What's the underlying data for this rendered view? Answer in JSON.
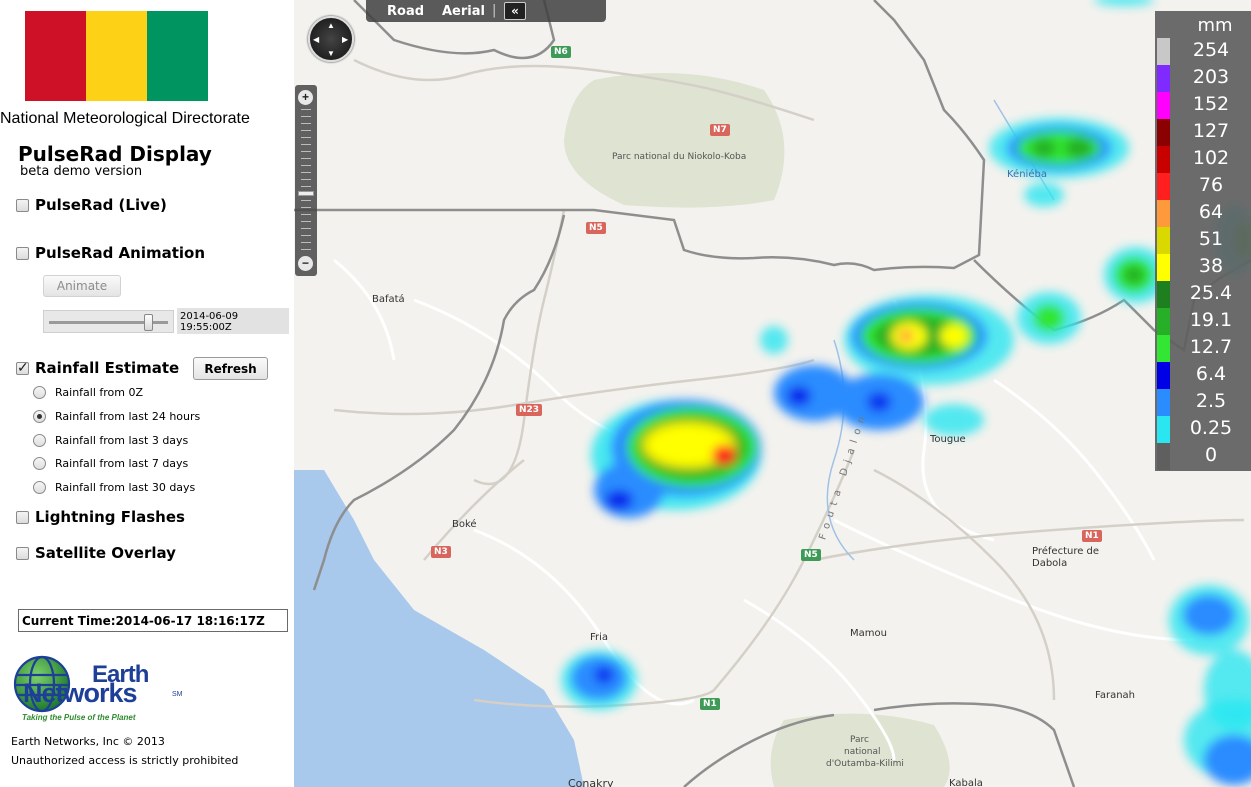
{
  "sidebar": {
    "flag_colors": [
      "#ce1126",
      "#fcd116",
      "#009460"
    ],
    "org_name": "National Meteorological Directorate",
    "app_title": "PulseRad Display",
    "app_subtitle": "beta demo version",
    "layers": {
      "pulserad_live": {
        "label": "PulseRad (Live)",
        "checked": false
      },
      "pulserad_animation": {
        "label": "PulseRad Animation",
        "checked": false
      },
      "rainfall_estimate": {
        "label": "Rainfall Estimate",
        "checked": true
      },
      "lightning": {
        "label": "Lightning Flashes",
        "checked": false
      },
      "satellite": {
        "label": "Satellite Overlay",
        "checked": false
      }
    },
    "animate_button": "Animate",
    "slider_time": "2014-06-09 19:55:00Z",
    "refresh_button": "Refresh",
    "rainfall_options": [
      {
        "label": "Rainfall from 0Z",
        "selected": false
      },
      {
        "label": "Rainfall from last 24 hours",
        "selected": true
      },
      {
        "label": "Rainfall from last 3 days",
        "selected": false
      },
      {
        "label": "Rainfall from last 7 days",
        "selected": false
      },
      {
        "label": "Rainfall from last 30 days",
        "selected": false
      }
    ],
    "current_time": "Current Time:2014-06-17 18:16:17Z",
    "logo": {
      "word1": "Earth",
      "word2": "Networks",
      "tm": "SM",
      "tagline": "Taking the Pulse of the Planet"
    },
    "copyright": "Earth Networks, Inc © 2013",
    "unauthorized": "Unauthorized access is strictly prohibited"
  },
  "map": {
    "map_types": {
      "road": "Road",
      "aerial": "Aerial",
      "separator": "|",
      "collapse": "«"
    },
    "zoom_in": "+",
    "zoom_out": "−",
    "places": {
      "niokolo": "Parc national du Niokolo-Koba",
      "kenieba": "Kéniéba",
      "bafata": "Bafatá",
      "tougue": "Tougue",
      "boke": "Boké",
      "prefecture": "Préfecture de",
      "dabola": "Dabola",
      "mamou": "Mamou",
      "fria": "Fria",
      "faranah": "Faranah",
      "outamba1": "Parc",
      "outamba2": "national",
      "outamba3": "d'Outamba-Kilimi",
      "conakry": "Conakry",
      "kabala": "Kabala",
      "fouta": "Fouta Djalon"
    },
    "roads": {
      "n6": "N6",
      "n7": "N7",
      "n5a": "N5",
      "n23": "N23",
      "n3": "N3",
      "n5b": "N5",
      "n1a": "N1",
      "n1b": "N1"
    },
    "legend": {
      "unit": "mm",
      "entries": [
        {
          "value": "254",
          "color": "#c8c8c8"
        },
        {
          "value": "203",
          "color": "#7f2bff"
        },
        {
          "value": "152",
          "color": "#ff00ff"
        },
        {
          "value": "127",
          "color": "#8b0000"
        },
        {
          "value": "102",
          "color": "#c80000"
        },
        {
          "value": "76",
          "color": "#ff1f1f"
        },
        {
          "value": "64",
          "color": "#ff9a3c"
        },
        {
          "value": "51",
          "color": "#d9d900"
        },
        {
          "value": "38",
          "color": "#ffff00"
        },
        {
          "value": "25.4",
          "color": "#1e7f1e"
        },
        {
          "value": "19.1",
          "color": "#27b027"
        },
        {
          "value": "12.7",
          "color": "#33e633"
        },
        {
          "value": "6.4",
          "color": "#0000e6"
        },
        {
          "value": "2.5",
          "color": "#2b8cff"
        },
        {
          "value": "0.25",
          "color": "#29e6f0"
        },
        {
          "value": "0",
          "color": "#5f5f5f"
        }
      ]
    }
  }
}
